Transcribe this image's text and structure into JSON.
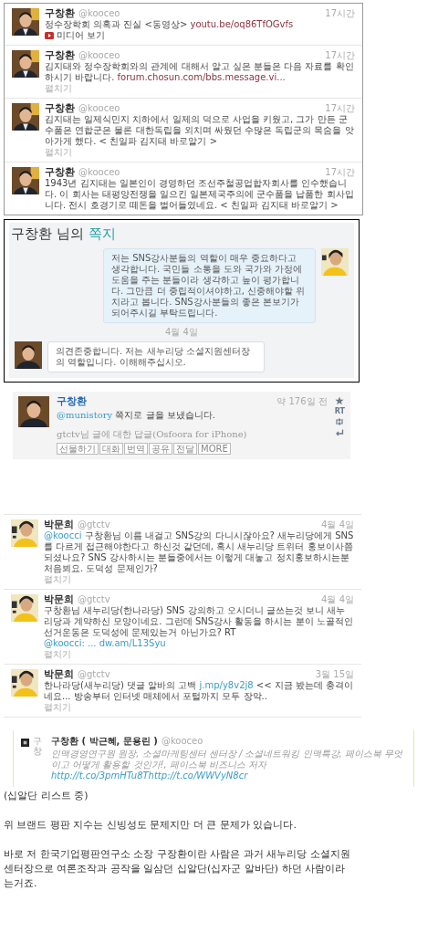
{
  "top_tweets": [
    {
      "name": "구창환",
      "handle": "@kooceo",
      "time": "17시간",
      "segments": [
        {
          "kind": "text",
          "text": "정수장학회 의혹과 진실 <동영상> "
        },
        {
          "kind": "link",
          "text": "youtu.be/oq86TfOGvfs"
        }
      ],
      "media": "미디어 보기"
    },
    {
      "name": "구창환",
      "handle": "@kooceo",
      "time": "17시간",
      "segments": [
        {
          "kind": "text",
          "text": "김지태와 정수장학회와의 관계에 대해서 알고 싶은 분들은 다음 자료를 확인하시기 바랍니다. "
        },
        {
          "kind": "link",
          "text": "forum.chosun.com/bbs.message.vi..."
        }
      ],
      "expand": "펼치기"
    },
    {
      "name": "구창환",
      "handle": "@kooceo",
      "time": "17시간",
      "segments": [
        {
          "kind": "text",
          "text": "김지태는 일제식민지 치하에서 일제의 덕으로 사업을 키웠고, 그가 만든 군수품은 연합군은 물론 대한독립을 외치며 싸웠던 수많은 독립군의 목숨을 앗아가게 했다. < 친일파 김지태 바로알기 >"
        }
      ],
      "expand": "펼치기"
    },
    {
      "name": "구창환",
      "handle": "@kooceo",
      "time": "17시간",
      "segments": [
        {
          "kind": "text",
          "text": "1943년 김지태는 일본인이 경영하던 조선주철공업합자회사를 인수했습니다. 이 회사는 태평양전쟁을 일으킨 일본제국주의에 군수품을 납품한 회사입니다. 전시 호경기로 떼돈을 벌어들였네요. < 친일파 김지태 바로알기 >"
        }
      ]
    }
  ],
  "message_panel": {
    "title": "구창환 님의 ",
    "title_accent": "쪽지",
    "messages": [
      {
        "kind": "sent",
        "text": "저는 SNS강사분들의 역할이 매우 중요하다고 생각합니다. 국민들 소통을 도와 국가와 가정에 도움을 주는 분들이라 생각하고 높이 평가합니다. 그만큼 더 중립적이셔야하고, 신중해야할 위치라고 봅니다. SNS강사분들의 좋은 본보기가 되어주시길 부탁드립니다."
      },
      {
        "kind": "received",
        "date": "4월 4일",
        "text": "의견존중합니다. 저는 새누리당 소셜지원센터장의 역할입니다. 이해해주십시오."
      }
    ]
  },
  "reply_tweet": {
    "name": "구창환",
    "time": "약 176일 전",
    "segments": [
      {
        "kind": "link",
        "text": "@munistory"
      },
      {
        "kind": "text",
        "text": " 쪽지로 글을 보냈습니다."
      }
    ],
    "source": "gtctv님 글에 대한 답글(Osfoora for iPhone)",
    "actions": [
      "선물하기",
      "대화",
      "번역",
      "공유",
      "전달",
      "MORE"
    ],
    "retweet_label": "RT"
  },
  "bottom_tweets": [
    {
      "name": "박문희",
      "handle": "@gtctv",
      "time": "4월 4일",
      "segments": [
        {
          "kind": "link",
          "text": "@koocci"
        },
        {
          "kind": "text",
          "text": " 구창환님 이름 내걸고 SNS강의 다니시잖아요? 새누리당에게 SNS를 다르게 접근해야한다고 하신것 같던데, 혹시 새누리당 트위터 홍보이사쯤 되셨나요? SNS 강사하시는 분들중에서는 이렇게 대놓고 정치홍보하시는분 처음뵈요. 도덕성 문제인가?"
        }
      ],
      "expand": "펼치기"
    },
    {
      "name": "박문희",
      "handle": "@gtctv",
      "time": "4월 4일",
      "segments": [
        {
          "kind": "text",
          "text": "구창환님 새누리당(한나라당) SNS 강의하고 오시더니 글쓰는것 보니 새누리당과 계약하신 모양이네요. 그런데 SNS강사 활동을 하시는 분이 노골적인 선거운동은 도덕성에 문제있는거 아닌가요? RT "
        },
        {
          "kind": "link",
          "text": "@koocci: ... dw.am/L13Syu"
        }
      ],
      "expand": "펼치기"
    },
    {
      "name": "박문희",
      "handle": "@gtctv",
      "time": "3월 15일",
      "segments": [
        {
          "kind": "text",
          "text": "한나라당(새누리당) 댓글 알바의 고백 "
        },
        {
          "kind": "link",
          "text": "j.mp/y8v2j8"
        },
        {
          "kind": "text",
          "text": " << 지금 봤는데 충격이네요... 방송부터 인터넷 매체에서 포털까지 모두 장악.."
        }
      ],
      "expand": "펼치기"
    }
  ],
  "profile_card": {
    "side_label": "구창",
    "name": "구창환 ( 박근혜, 문용린 )",
    "handle": "@kooceo",
    "bio": "인맥경영연구원 원장, 소셜마케팅센터 센터장 / 소셜네트워킹 인맥특강, 페이스북 무엇이고 어떻게 활용할 것인가!, 페이스북 비즈니스 저자",
    "bio_link": "http://t.co/3pmHTu8Thttp://t.co/WWVyN8cr"
  },
  "paragraphs": [
    "(십알단 리스트 중)",
    "위 브랜드 평판 지수는 신빙성도 문제지만 더 큰 문제가 있습니다.",
    "바로 저 한국기업평판연구소  소장 구장환이란 사람은 과거 새누리당 소셜지원센터장으로 여론조작과 공작을 일삼던 십알단(십자군 알바단) 하던 사람이라는거죠."
  ]
}
